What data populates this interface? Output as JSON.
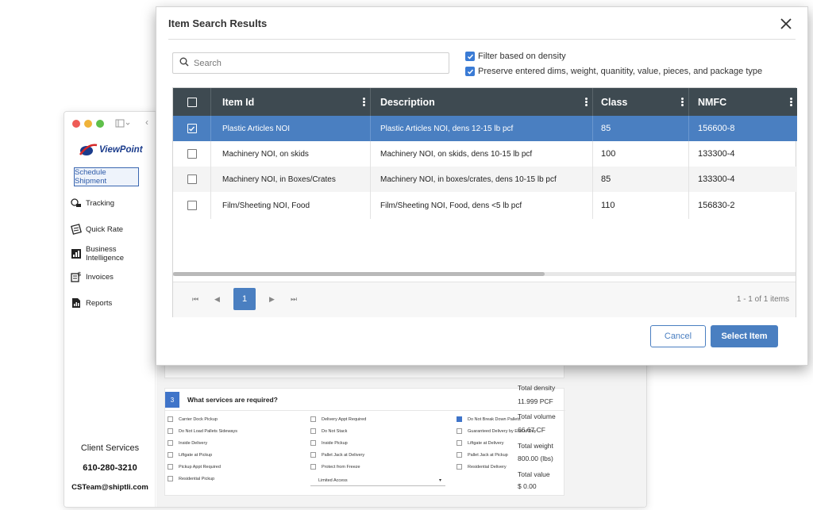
{
  "sidebar": {
    "logo_text": "ViewPoint",
    "schedule_button": "Schedule Shipment",
    "items": [
      {
        "label": "Tracking",
        "icon": "tracking-icon"
      },
      {
        "label": "Quick Rate",
        "icon": "quick-rate-icon"
      },
      {
        "label": "Business Intelligence",
        "icon": "business-intelligence-icon"
      },
      {
        "label": "Invoices",
        "icon": "invoices-icon"
      },
      {
        "label": "Reports",
        "icon": "reports-icon"
      }
    ],
    "client_services": {
      "title": "Client Services",
      "phone": "610-280-3210",
      "email": "CSTeam@shiptli.com"
    }
  },
  "services": {
    "step_number": "3",
    "question": "What services are required?",
    "col1": [
      {
        "label": "Carrier Dock Pickup",
        "checked": false
      },
      {
        "label": "Do Not Load Pallets Sideways",
        "checked": false
      },
      {
        "label": "Inside Delivery",
        "checked": false
      },
      {
        "label": "Liftgate at Pickup",
        "checked": false
      },
      {
        "label": "Pickup Appt Required",
        "checked": false
      },
      {
        "label": "Residential Pickup",
        "checked": false
      }
    ],
    "col2": [
      {
        "label": "Delivery Appt Required",
        "checked": false
      },
      {
        "label": "Do Not Stack",
        "checked": false
      },
      {
        "label": "Inside Pickup",
        "checked": false
      },
      {
        "label": "Pallet Jack at Delivery",
        "checked": false
      },
      {
        "label": "Protect from Freeze",
        "checked": false
      }
    ],
    "col3": [
      {
        "label": "Do Not Break Down Pallets",
        "checked": true
      },
      {
        "label": "Guaranteed Delivery by End of Day",
        "checked": false
      },
      {
        "label": "Liftgate at Delivery",
        "checked": false
      },
      {
        "label": "Pallet Jack at Pickup",
        "checked": false
      },
      {
        "label": "Residential Delivery",
        "checked": false
      }
    ],
    "access_select": "Limited Access"
  },
  "totals": {
    "density_label": "Total density",
    "density_value": "11.999 PCF",
    "volume_label": "Total volume",
    "volume_value": "66.67 CF",
    "weight_label": "Total weight",
    "weight_value": "800.00 (lbs)",
    "value_label": "Total value",
    "value_value": "$ 0.00"
  },
  "modal": {
    "title": "Item Search Results",
    "search_placeholder": "Search",
    "filter_density": "Filter based on density",
    "preserve_entered": "Preserve entered dims, weight, quanitity, value, pieces, and package type",
    "columns": [
      "Item Id",
      "Description",
      "Class",
      "NMFC"
    ],
    "rows": [
      {
        "item_id": "Plastic Articles NOI",
        "description": "Plastic Articles NOI, dens 12-15 lb pcf",
        "class": "85",
        "nmfc": "156600-8",
        "selected": true
      },
      {
        "item_id": "Machinery NOI, on skids",
        "description": "Machinery NOI, on skids, dens 10-15 lb pcf",
        "class": "100",
        "nmfc": "133300-4",
        "selected": false
      },
      {
        "item_id": "Machinery NOI, in Boxes/Crates",
        "description": "Machinery NOI, in boxes/crates, dens 10-15 lb pcf",
        "class": "85",
        "nmfc": "133300-4",
        "selected": false
      },
      {
        "item_id": "Film/Sheeting NOI, Food",
        "description": "Film/Sheeting NOI, Food, dens <5 lb pcf",
        "class": "110",
        "nmfc": "156830-2",
        "selected": false
      }
    ],
    "pager": {
      "current_page": "1",
      "info": "1 - 1 of 1 items"
    },
    "cancel_label": "Cancel",
    "select_label": "Select Item"
  }
}
